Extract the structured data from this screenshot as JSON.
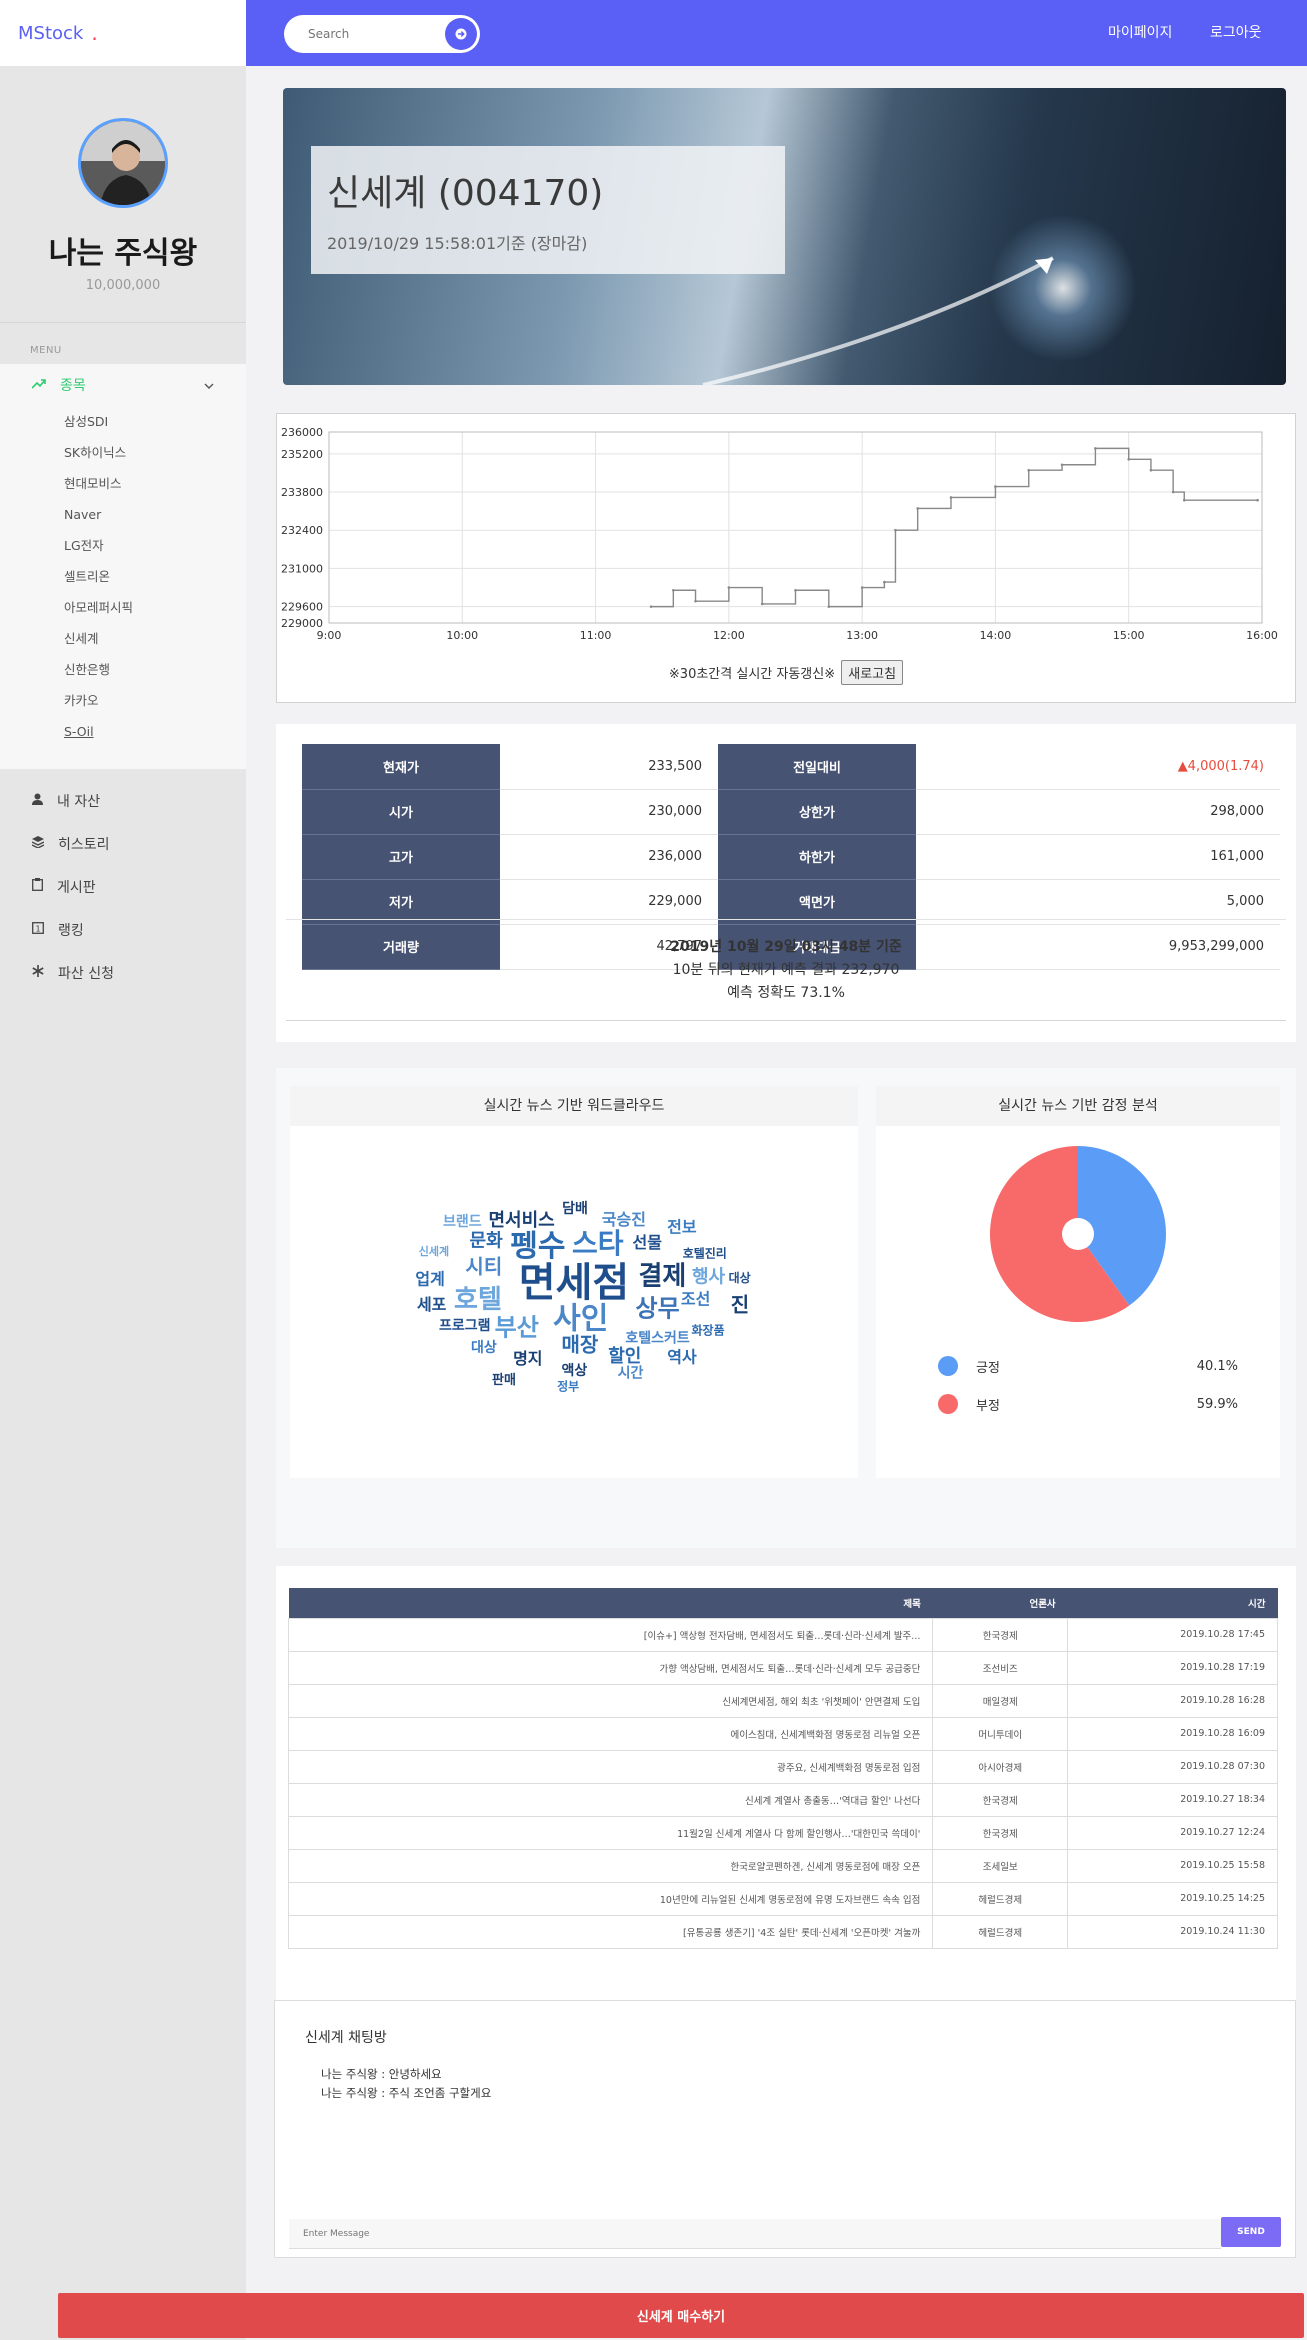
{
  "brand": {
    "name": "MStock",
    "dot": "."
  },
  "search": {
    "placeholder": "Search"
  },
  "topnav": {
    "mypage": "마이페이지",
    "logout": "로그아웃"
  },
  "profile": {
    "name": "나는 주식왕",
    "balance": "10,000,000"
  },
  "sidebar": {
    "menu_title": "MENU",
    "stocks_label": "종목",
    "stocks": [
      "삼성SDI",
      "SK하이닉스",
      "현대모비스",
      "Naver",
      "LG전자",
      "셀트리온",
      "아모레퍼시픽",
      "신세계",
      "신한은행",
      "카카오",
      "S-Oil"
    ],
    "items": [
      {
        "label": "내 자산",
        "icon": "person-icon"
      },
      {
        "label": "히스토리",
        "icon": "layers-icon"
      },
      {
        "label": "게시판",
        "icon": "clipboard-icon"
      },
      {
        "label": "랭킹",
        "icon": "rank-icon"
      },
      {
        "label": "파산 신청",
        "icon": "asterisk-icon"
      }
    ]
  },
  "hero": {
    "title": "신세계 (004170)",
    "date": "2019/10/29 15:58:01기준 (장마감)"
  },
  "chart_note": "※30초간격 실시간 자동갱신※",
  "refresh_label": "새로고침",
  "chart_data": {
    "type": "line",
    "title": "",
    "xlabel": "",
    "ylabel": "",
    "x_ticks": [
      "9:00",
      "10:00",
      "11:00",
      "12:00",
      "13:00",
      "14:00",
      "15:00",
      "16:00"
    ],
    "y_ticks": [
      229000,
      229600,
      231000,
      232400,
      233800,
      235200,
      236000
    ],
    "ylim": [
      229000,
      236000
    ],
    "grid": true,
    "series": [
      {
        "color": "#888888",
        "points": [
          [
            "11:25",
            229600
          ],
          [
            "11:35",
            230200
          ],
          [
            "11:45",
            229800
          ],
          [
            "12:00",
            230300
          ],
          [
            "12:15",
            229700
          ],
          [
            "12:30",
            230200
          ],
          [
            "12:45",
            229600
          ],
          [
            "13:00",
            230300
          ],
          [
            "13:10",
            230500
          ],
          [
            "13:15",
            232400
          ],
          [
            "13:25",
            233200
          ],
          [
            "13:40",
            233600
          ],
          [
            "14:00",
            234000
          ],
          [
            "14:15",
            234600
          ],
          [
            "14:30",
            234800
          ],
          [
            "14:45",
            235400
          ],
          [
            "15:00",
            235000
          ],
          [
            "15:10",
            234600
          ],
          [
            "15:20",
            233800
          ],
          [
            "15:25",
            233500
          ],
          [
            "15:58",
            233500
          ]
        ]
      }
    ]
  },
  "quote": {
    "rows": [
      {
        "l_label": "현재가",
        "l_value": "233,500",
        "r_label": "전일대비",
        "r_value": "▲4,000(1.74)"
      },
      {
        "l_label": "시가",
        "l_value": "230,000",
        "r_label": "상한가",
        "r_value": "298,000"
      },
      {
        "l_label": "고가",
        "l_value": "236,000",
        "r_label": "하한가",
        "r_value": "161,000"
      },
      {
        "l_label": "저가",
        "l_value": "229,000",
        "r_label": "액면가",
        "r_value": "5,000"
      },
      {
        "l_label": "거래량",
        "l_value": "42,797",
        "r_label": "거래대금",
        "r_value": "9,953,299,000"
      }
    ],
    "change_color": "#e74c3c"
  },
  "prediction": {
    "line1": "2019년 10월 29일 03시 48분 기준",
    "line2": "10분 뒤의 현재가 예측 결과 232,970",
    "line3": "예측 정확도 73.1%"
  },
  "wordcloud": {
    "title": "실시간 뉴스 기반 워드클라우드",
    "words": [
      {
        "t": "면세점",
        "s": 40,
        "c": "#1f4e8c"
      },
      {
        "t": "사인",
        "s": 30,
        "c": "#4a86c8"
      },
      {
        "t": "펭수",
        "s": 30,
        "c": "#2c6ab0"
      },
      {
        "t": "스타",
        "s": 28,
        "c": "#3a7cc4"
      },
      {
        "t": "결제",
        "s": 26,
        "c": "#1a3f73"
      },
      {
        "t": "상무",
        "s": 24,
        "c": "#3c73b8"
      },
      {
        "t": "부산",
        "s": 24,
        "c": "#5a9bd5"
      },
      {
        "t": "호텔",
        "s": 26,
        "c": "#6ca6dc"
      },
      {
        "t": "시티",
        "s": 20,
        "c": "#4a86c8"
      },
      {
        "t": "매장",
        "s": 20,
        "c": "#2c6ab0"
      },
      {
        "t": "선물",
        "s": 16,
        "c": "#1f4e8c"
      },
      {
        "t": "조선",
        "s": 16,
        "c": "#3a7cc4"
      },
      {
        "t": "호텔스커트",
        "s": 14,
        "c": "#4a86c8"
      },
      {
        "t": "프로그램",
        "s": 14,
        "c": "#1f4e8c"
      },
      {
        "t": "문화",
        "s": 18,
        "c": "#2c6ab0"
      },
      {
        "t": "행사",
        "s": 18,
        "c": "#6ca6dc"
      },
      {
        "t": "할인",
        "s": 18,
        "c": "#2c6ab0"
      },
      {
        "t": "명지",
        "s": 16,
        "c": "#1a3f73"
      },
      {
        "t": "대상",
        "s": 14,
        "c": "#3a7cc4"
      },
      {
        "t": "세포",
        "s": 16,
        "c": "#1f4e8c"
      },
      {
        "t": "업계",
        "s": 16,
        "c": "#2c6ab0"
      },
      {
        "t": "면서비스",
        "s": 18,
        "c": "#1a3f73"
      },
      {
        "t": "국승진",
        "s": 16,
        "c": "#4a86c8"
      },
      {
        "t": "호텔진리",
        "s": 12,
        "c": "#1f4e8c"
      },
      {
        "t": "화장품",
        "s": 12,
        "c": "#2c6ab0"
      },
      {
        "t": "액상",
        "s": 14,
        "c": "#1a3f73"
      },
      {
        "t": "신세계",
        "s": 11,
        "c": "#6ca6dc"
      },
      {
        "t": "담배",
        "s": 14,
        "c": "#1a3f73"
      },
      {
        "t": "전보",
        "s": 16,
        "c": "#3a7cc4"
      },
      {
        "t": "대상",
        "s": 12,
        "c": "#1f4e8c"
      },
      {
        "t": "진",
        "s": 20,
        "c": "#1a3f73"
      },
      {
        "t": "역사",
        "s": 16,
        "c": "#2c6ab0"
      },
      {
        "t": "시간",
        "s": 14,
        "c": "#4a86c8"
      },
      {
        "t": "브랜드",
        "s": 14,
        "c": "#6ca6dc"
      },
      {
        "t": "정부",
        "s": 12,
        "c": "#3a7cc4"
      },
      {
        "t": "판매",
        "s": 13,
        "c": "#1a3f73"
      }
    ]
  },
  "sentiment": {
    "title": "실시간 뉴스 기반 감정 분석",
    "positive_label": "긍정",
    "positive_value": "40.1%",
    "positive_fraction": 0.401,
    "positive_color": "#5b9cf6",
    "negative_label": "부정",
    "negative_value": "59.9%",
    "negative_fraction": 0.599,
    "negative_color": "#f86a6a"
  },
  "news": {
    "headers": [
      "제목",
      "언론사",
      "시간"
    ],
    "rows": [
      [
        "[이슈+] 액상형 전자담배, 면세점서도 퇴출…롯데·신라·신세계 발주...",
        "한국경제",
        "2019.10.28 17:45"
      ],
      [
        "가향 액상담배, 면세점서도 퇴출…롯데·신라·신세계 모두 공급중단",
        "조선비즈",
        "2019.10.28 17:19"
      ],
      [
        "신세계면세점, 해외 최초 '위챗페이' 안면결제 도입",
        "매일경제",
        "2019.10.28 16:28"
      ],
      [
        "에이스침대, 신세계백화점 명동로점 리뉴얼 오픈",
        "머니투데이",
        "2019.10.28 16:09"
      ],
      [
        "광주요, 신세계백화점 명동로점 입점",
        "아시아경제",
        "2019.10.28 07:30"
      ],
      [
        "신세계 계열사 총출동…'역대급 할인' 나선다",
        "한국경제",
        "2019.10.27 18:34"
      ],
      [
        "11월2일 신세계 계열사 다 함께 할인행사…'대한민국 쓱데이'",
        "한국경제",
        "2019.10.27 12:24"
      ],
      [
        "한국로얄코펜하겐, 신세계 명동로점에 매장 오픈",
        "조세일보",
        "2019.10.25 15:58"
      ],
      [
        "10년만에 리뉴얼된 신세계 명동로점에 유명 도자브랜드 속속 입점",
        "헤럴드경제",
        "2019.10.25 14:25"
      ],
      [
        "[유통공룡 생존기] '4조 실탄' 롯데·신세계 '오픈마켓' 겨눌까",
        "헤럴드경제",
        "2019.10.24 11:30"
      ]
    ]
  },
  "chat": {
    "title": "신세계 채팅방",
    "messages": [
      "나는 주식왕 : 안녕하세요",
      "나는 주식왕 : 주식 조언좀 구할게요"
    ],
    "placeholder": "Enter Message",
    "send_label": "SEND"
  },
  "buy_label": "신세계 매수하기"
}
